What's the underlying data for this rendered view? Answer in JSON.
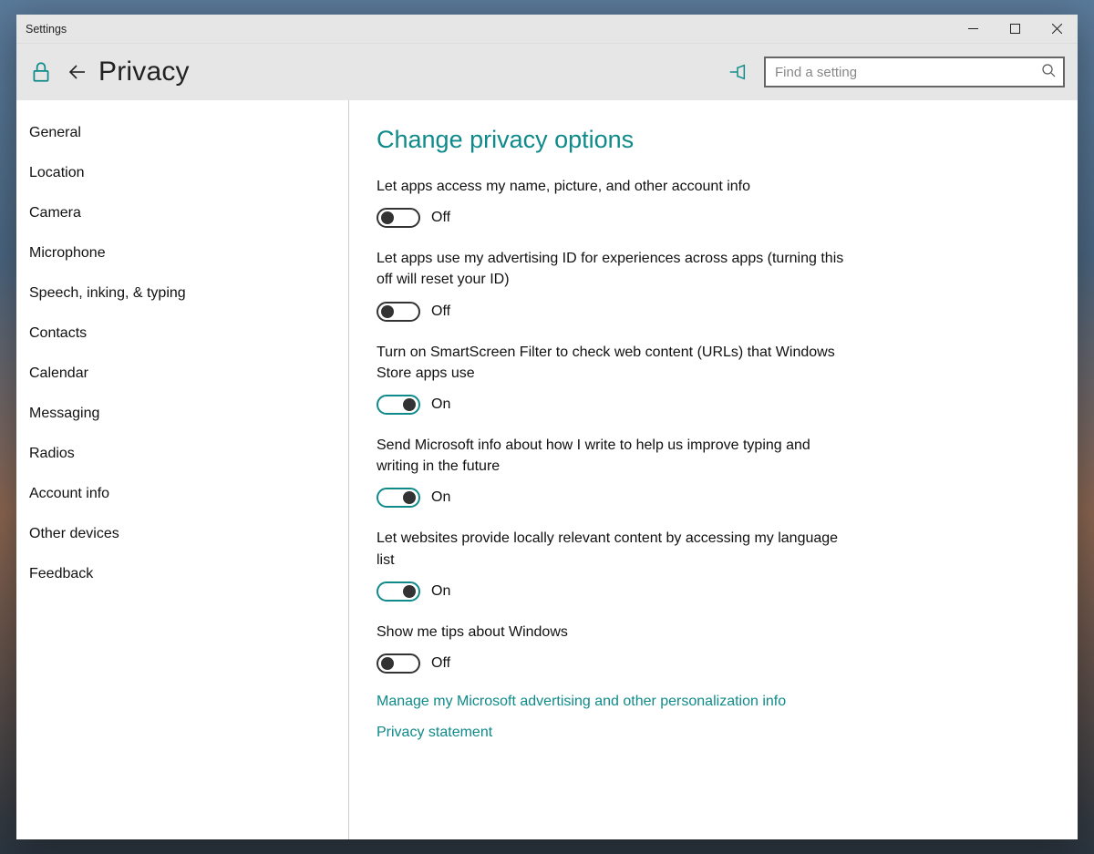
{
  "window": {
    "title": "Settings"
  },
  "header": {
    "page_title": "Privacy",
    "search_placeholder": "Find a setting"
  },
  "sidebar": {
    "items": [
      {
        "label": "General"
      },
      {
        "label": "Location"
      },
      {
        "label": "Camera"
      },
      {
        "label": "Microphone"
      },
      {
        "label": "Speech, inking, & typing"
      },
      {
        "label": "Contacts"
      },
      {
        "label": "Calendar"
      },
      {
        "label": "Messaging"
      },
      {
        "label": "Radios"
      },
      {
        "label": "Account info"
      },
      {
        "label": "Other devices"
      },
      {
        "label": "Feedback"
      }
    ]
  },
  "main": {
    "heading": "Change privacy options",
    "settings": [
      {
        "label": "Let apps access my name, picture, and other account info",
        "on": false,
        "state": "Off"
      },
      {
        "label": "Let apps use my advertising ID for experiences across apps (turning this off will reset your ID)",
        "on": false,
        "state": "Off"
      },
      {
        "label": "Turn on SmartScreen Filter to check web content (URLs) that Windows Store apps use",
        "on": true,
        "state": "On"
      },
      {
        "label": "Send Microsoft info about how I write to help us improve typing and writing in the future",
        "on": true,
        "state": "On"
      },
      {
        "label": "Let websites provide locally relevant content by accessing my language list",
        "on": true,
        "state": "On"
      },
      {
        "label": "Show me tips about Windows",
        "on": false,
        "state": "Off"
      }
    ],
    "links": [
      {
        "label": "Manage my Microsoft advertising and other personalization info"
      },
      {
        "label": "Privacy statement"
      }
    ]
  },
  "colors": {
    "accent": "#0f8a8a"
  }
}
